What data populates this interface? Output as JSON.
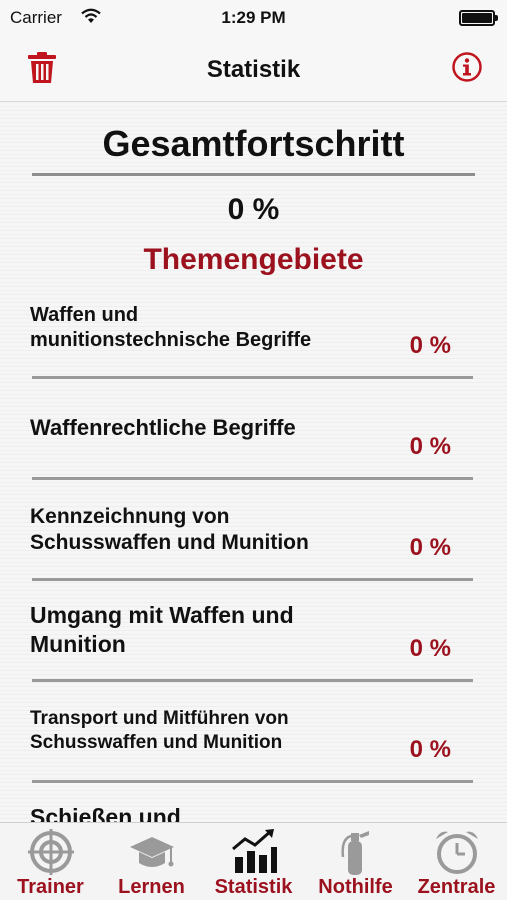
{
  "status": {
    "carrier": "Carrier",
    "time": "1:29 PM"
  },
  "nav": {
    "title": "Statistik",
    "left_icon": "trash-icon",
    "right_icon": "info-icon"
  },
  "overall": {
    "heading": "Gesamtfortschritt",
    "value": "0 %"
  },
  "section_title": "Themengebiete",
  "topics": [
    {
      "label_lines": [
        "Waffen und",
        "munitionstechnische Begriffe"
      ],
      "value": "0 %"
    },
    {
      "label_lines": [
        "Waffenrechtliche Begriffe"
      ],
      "value": "0 %"
    },
    {
      "label_lines": [
        "Kennzeichnung von",
        "Schusswaffen und Munition"
      ],
      "value": "0 %"
    },
    {
      "label_lines": [
        "Umgang mit Waffen und",
        "Munition"
      ],
      "value": "0 %"
    },
    {
      "label_lines": [
        "Transport und Mitführen von",
        "Schusswaffen und Munition"
      ],
      "value": "0 %"
    },
    {
      "label_lines": [
        "Schießen und"
      ],
      "value": ""
    }
  ],
  "tabs": [
    {
      "label": "Trainer",
      "icon": "target-icon"
    },
    {
      "label": "Lernen",
      "icon": "graduation-cap-icon"
    },
    {
      "label": "Statistik",
      "icon": "bar-chart-icon",
      "active": true
    },
    {
      "label": "Nothilfe",
      "icon": "fire-extinguisher-icon"
    },
    {
      "label": "Zentrale",
      "icon": "alarm-clock-icon"
    }
  ],
  "colors": {
    "accent": "#9b111e",
    "text": "#111111",
    "divider": "#9a9a9a"
  }
}
